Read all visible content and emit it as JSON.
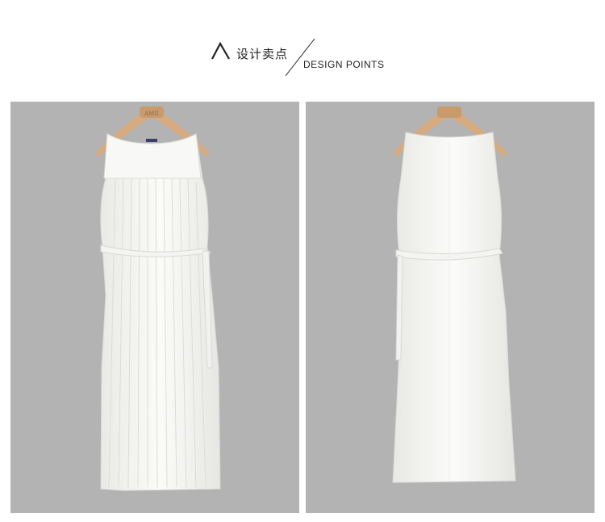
{
  "header": {
    "logo_icon": "caret-lambda-icon",
    "title_cn": "设计卖点",
    "title_en": "DESIGN POINTS"
  },
  "images": [
    {
      "name": "front-view",
      "description_icon": "dress-on-hanger-front"
    },
    {
      "name": "back-view",
      "description_icon": "dress-on-hanger-back"
    }
  ],
  "hanger_brand": "AMII",
  "colors": {
    "background": "#ffffff",
    "panel": "#b3b3b3",
    "dress": "#f6f6f4",
    "hanger": "#d9b28c",
    "text": "#222222"
  }
}
